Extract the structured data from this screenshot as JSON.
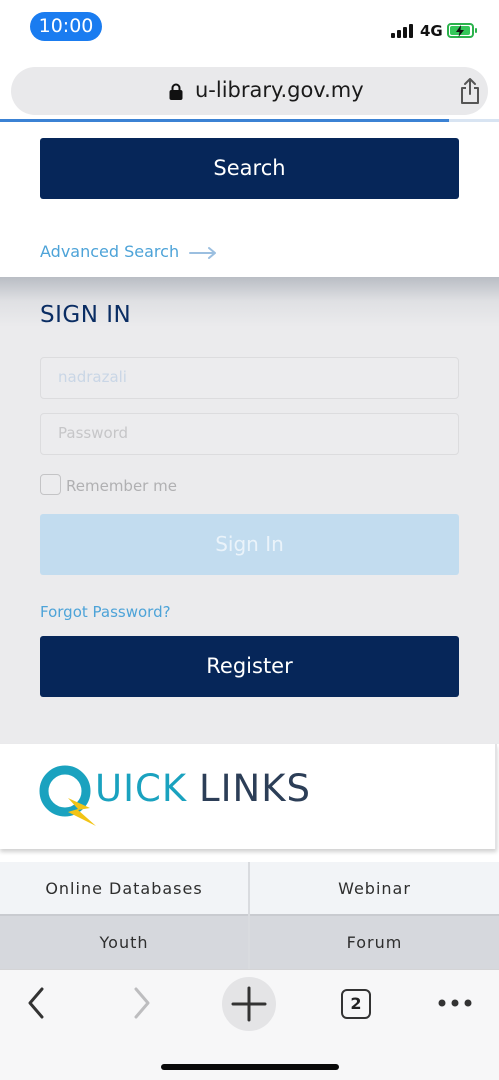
{
  "status_bar": {
    "time": "10:00",
    "network": "4G",
    "icons": [
      "signal-bars-icon",
      "battery-charging-icon"
    ]
  },
  "browser": {
    "url": "u-library.gov.my",
    "icons": [
      "lock-icon",
      "share-icon"
    ],
    "load_progress": 0.9
  },
  "search": {
    "button_label": "Search",
    "advanced_link": "Advanced Search",
    "advanced_icon": "arrow-right-icon"
  },
  "signin": {
    "title": "SIGN IN",
    "username_value": "nadrazali",
    "password_placeholder": "Password",
    "remember_label": "Remember me",
    "remember_checked": false,
    "signin_label": "Sign In",
    "forgot_link": "Forgot Password?",
    "register_label": "Register"
  },
  "quick_links": {
    "word1": "UICK",
    "word2": "LINKS",
    "logo_icon": "q-lightning-logo",
    "items": [
      {
        "label": "Online Databases"
      },
      {
        "label": "Webinar"
      },
      {
        "label": "Youth"
      },
      {
        "label": "Forum"
      }
    ]
  },
  "toolbar": {
    "tab_count": "2",
    "icons": [
      "back-icon",
      "forward-icon",
      "new-tab-icon",
      "tabs-icon",
      "more-icon"
    ]
  },
  "colors": {
    "navy": "#062659",
    "link_blue": "#4da3d8",
    "signin_disabled": "#c2dcef",
    "status_time_pill": "#1a7cf0",
    "logo_teal": "#1aa2bf",
    "logo_yellow": "#f2c416"
  }
}
